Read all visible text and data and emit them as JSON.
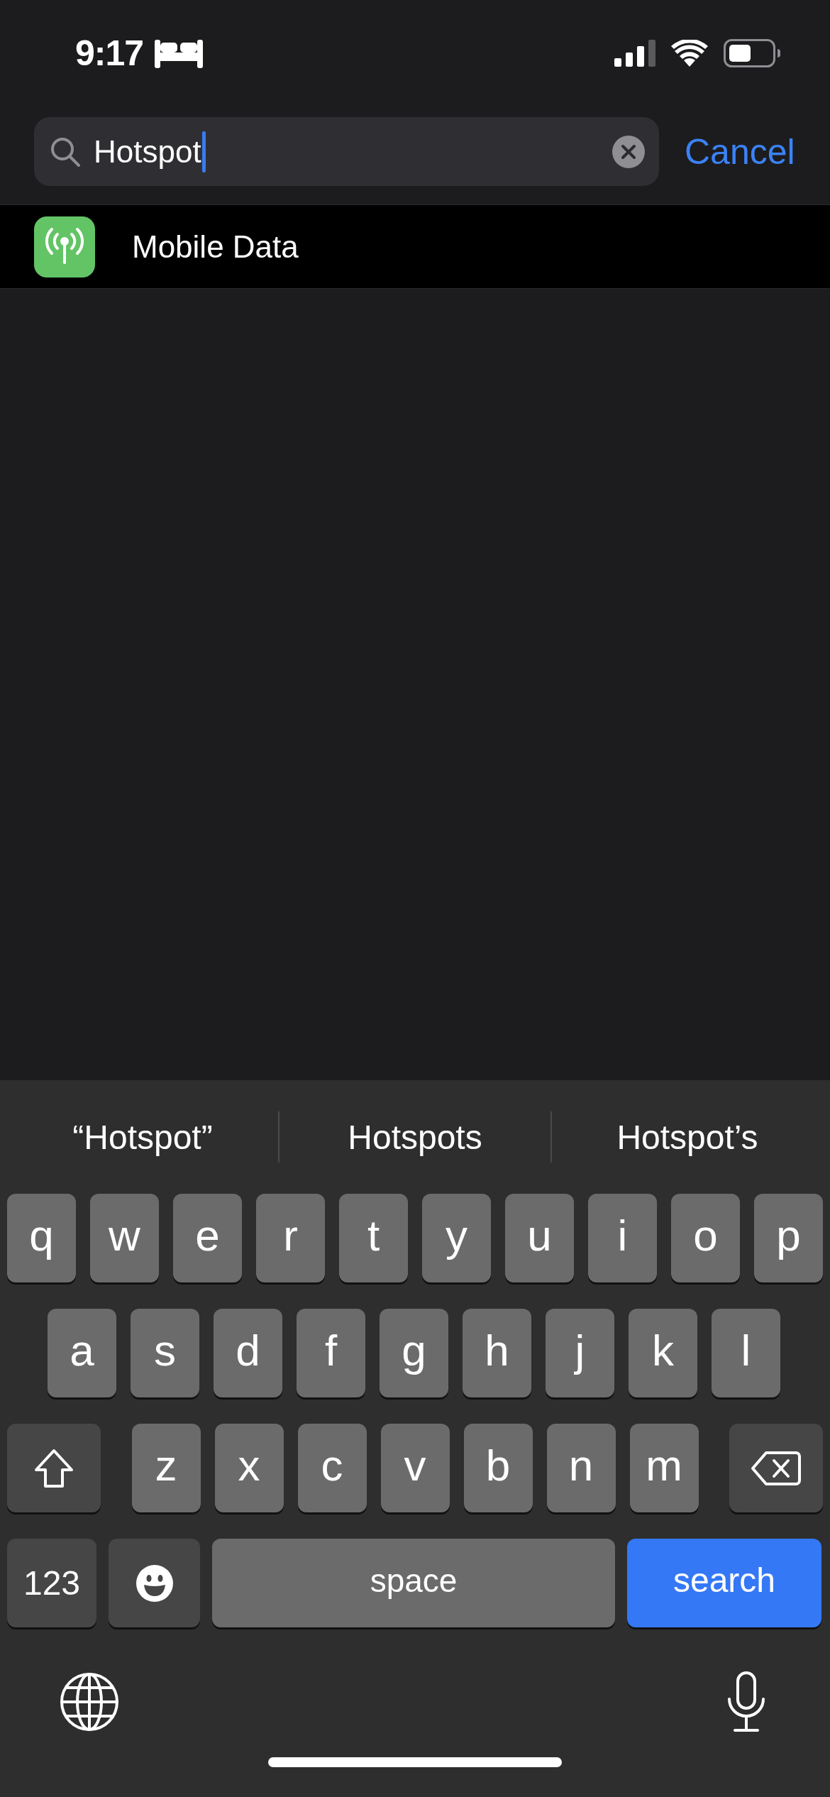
{
  "status_bar": {
    "time": "9:17"
  },
  "search": {
    "value": "Hotspot",
    "focused": true,
    "cancel": "Cancel"
  },
  "results": [
    {
      "label": "Mobile Data"
    }
  ],
  "keyboard": {
    "suggestions": [
      "“Hotspot”",
      "Hotspots",
      "Hotspot’s"
    ],
    "rows": [
      {
        "keys": [
          {
            "kind": "letter",
            "label": "q"
          },
          {
            "kind": "letter",
            "label": "w"
          },
          {
            "kind": "letter",
            "label": "e"
          },
          {
            "kind": "letter",
            "label": "r"
          },
          {
            "kind": "letter",
            "label": "t"
          },
          {
            "kind": "letter",
            "label": "y"
          },
          {
            "kind": "letter",
            "label": "u"
          },
          {
            "kind": "letter",
            "label": "i"
          },
          {
            "kind": "letter",
            "label": "o"
          },
          {
            "kind": "letter",
            "label": "p"
          }
        ]
      },
      {
        "keys": [
          {
            "kind": "letter",
            "label": "a"
          },
          {
            "kind": "letter",
            "label": "s"
          },
          {
            "kind": "letter",
            "label": "d"
          },
          {
            "kind": "letter",
            "label": "f"
          },
          {
            "kind": "letter",
            "label": "g"
          },
          {
            "kind": "letter",
            "label": "h"
          },
          {
            "kind": "letter",
            "label": "j"
          },
          {
            "kind": "letter",
            "label": "k"
          },
          {
            "kind": "letter",
            "label": "l"
          }
        ]
      },
      {
        "keys": [
          {
            "kind": "shift"
          },
          {
            "kind": "letter",
            "label": "z"
          },
          {
            "kind": "letter",
            "label": "x"
          },
          {
            "kind": "letter",
            "label": "c"
          },
          {
            "kind": "letter",
            "label": "v"
          },
          {
            "kind": "letter",
            "label": "b"
          },
          {
            "kind": "letter",
            "label": "n"
          },
          {
            "kind": "letter",
            "label": "m"
          },
          {
            "kind": "delete"
          }
        ]
      },
      {
        "keys": [
          {
            "kind": "numbers",
            "label": "123"
          },
          {
            "kind": "emoji"
          },
          {
            "kind": "space",
            "label": "space"
          },
          {
            "kind": "action",
            "label": "search"
          }
        ]
      }
    ]
  }
}
